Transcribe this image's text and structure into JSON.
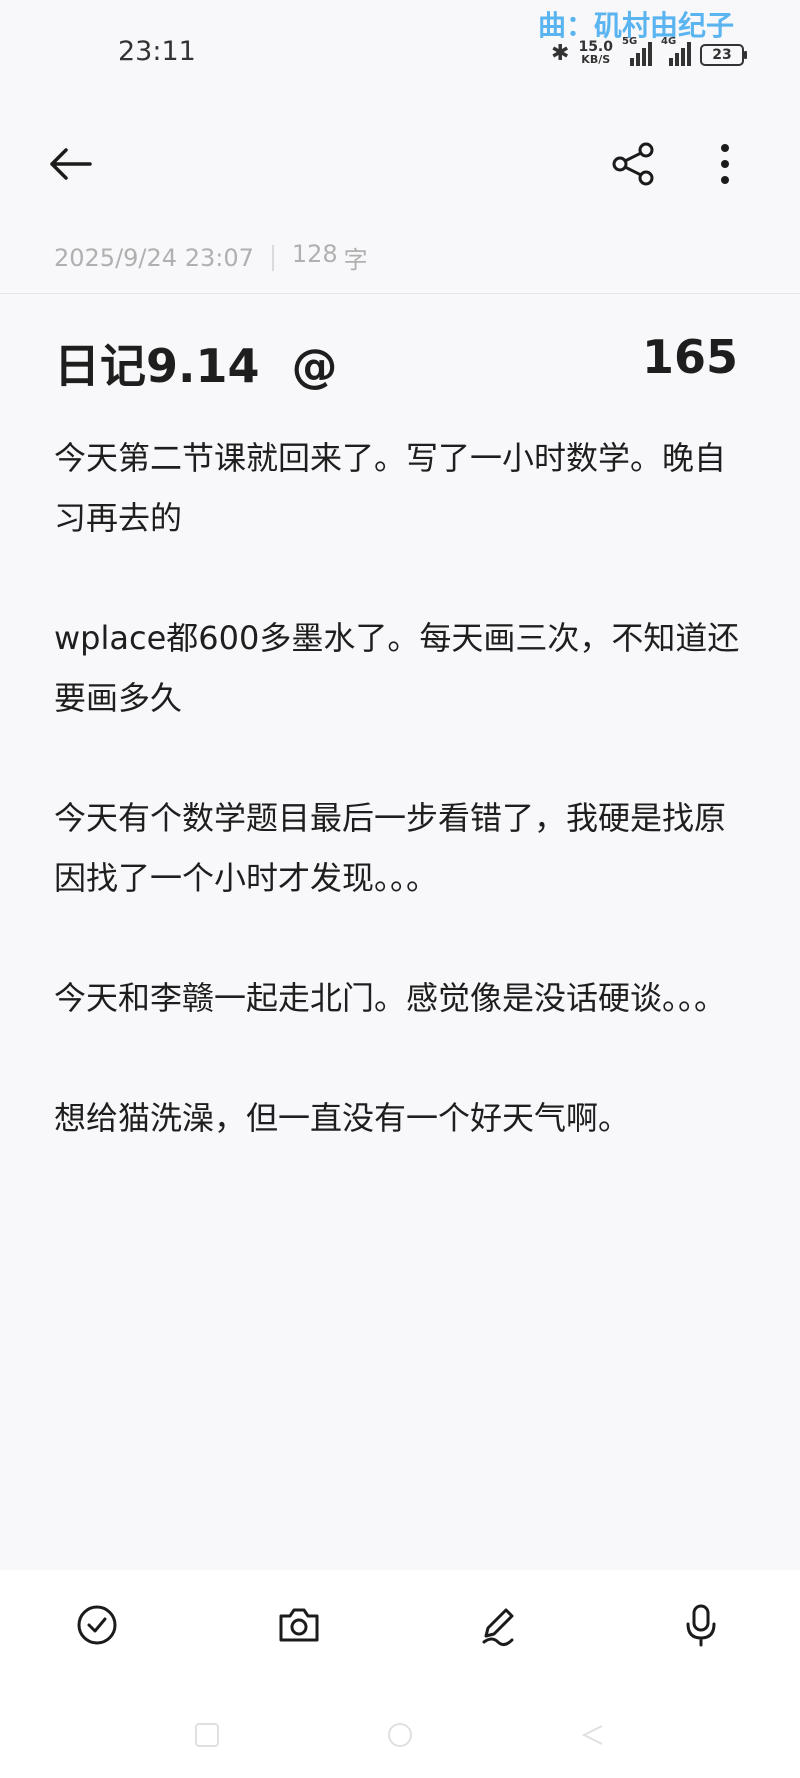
{
  "status_bar": {
    "time": "23:11",
    "now_playing": "曲：矶村由纪子",
    "net_speed_value": "15.0",
    "net_speed_unit": "KB/S",
    "signal1_label": "5G",
    "signal2_label": "4G",
    "battery": "23"
  },
  "header": {
    "back_icon": "arrow-left-icon",
    "share_icon": "share-icon",
    "more_icon": "more-vertical-icon"
  },
  "meta": {
    "datetime": "2025/9/24 23:07",
    "char_count": "128",
    "char_unit": "字"
  },
  "note": {
    "title": "日记9.14  @",
    "title_number": "165",
    "paragraphs": [
      "今天第二节课就回来了。写了一小时数学。晚自习再去的",
      "wplace都600多墨水了。每天画三次，不知道还要画多久",
      "今天有个数学题目最后一步看错了，我硬是找原因找了一个小时才发现。。。",
      "今天和李赣一起走北门。感觉像是没话硬谈。。。",
      "想给猫洗澡，但一直没有一个好天气啊。"
    ]
  },
  "toolbar": {
    "items": [
      "checklist-icon",
      "camera-icon",
      "pen-icon",
      "microphone-icon"
    ]
  },
  "colors": {
    "background": "#f8f8fa",
    "now_playing": "#5ab4f0",
    "meta_text": "#b0b0b0"
  }
}
